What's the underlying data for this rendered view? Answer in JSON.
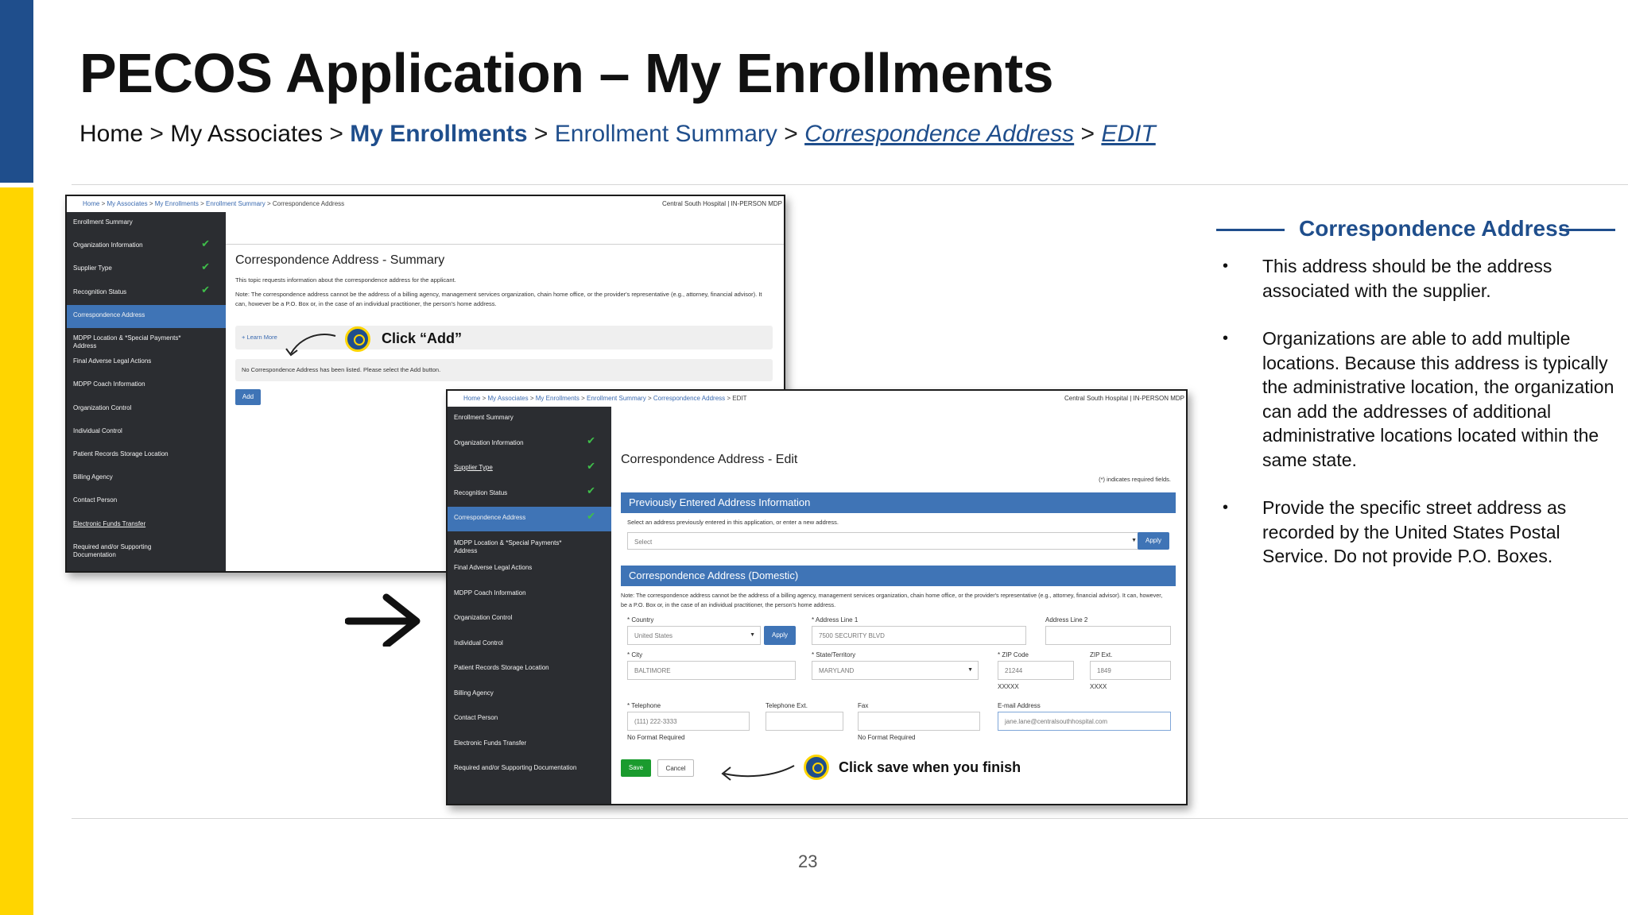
{
  "slide": {
    "title": "PECOS Application – My Enrollments",
    "page_number": "23",
    "breadcrumb": {
      "home": "Home",
      "sep": ">",
      "my_associates": "My Associates",
      "my_enrollments": "My Enrollments",
      "enrollment_summary": "Enrollment Summary",
      "correspondence_address": "Correspondence Address",
      "edit": "EDIT"
    }
  },
  "shot1": {
    "breadcrumb": [
      "Home",
      ">",
      "My Associates",
      ">",
      "My Enrollments",
      ">",
      "Enrollment Summary",
      ">",
      "Correspondence Address"
    ],
    "top_right": "Central South Hospital | IN-PERSON MDP",
    "sidebar": [
      {
        "label": "Enrollment Summary",
        "check": false
      },
      {
        "label": "Organization Information",
        "check": true
      },
      {
        "label": "Supplier Type",
        "check": true
      },
      {
        "label": "Recognition Status",
        "check": true
      },
      {
        "label": "Correspondence Address",
        "check": false,
        "active": true
      },
      {
        "label": "MDPP Location & *Special Payments* Address",
        "check": false
      },
      {
        "label": "Final Adverse Legal Actions",
        "check": false
      },
      {
        "label": "MDPP Coach Information",
        "check": false
      },
      {
        "label": "Organization Control",
        "check": false
      },
      {
        "label": "Individual Control",
        "check": false
      },
      {
        "label": "Patient Records Storage Location",
        "check": false
      },
      {
        "label": "Billing Agency",
        "check": false
      },
      {
        "label": "Contact Person",
        "check": false
      },
      {
        "label": "Electronic Funds Transfer",
        "check": false
      },
      {
        "label": "Required and/or Supporting Documentation",
        "check": false
      }
    ],
    "page_title": "Correspondence Address - Summary",
    "intro": "This topic requests information about the correspondence address for the applicant.",
    "note": "Note: The correspondence address cannot be the address of a billing agency, management services organization, chain home office, or the provider's representative (e.g., attorney, financial advisor). It can, however be a P.O. Box or, in the case of an individual practitioner, the person's home address.",
    "learn_more": "+ Learn More",
    "empty_msg": "No Correspondence Address has been listed. Please select the Add button.",
    "add_button": "Add",
    "callout": "Click “Add”"
  },
  "shot2": {
    "breadcrumb": [
      "Home",
      ">",
      "My Associates",
      ">",
      "My Enrollments",
      ">",
      "Enrollment Summary",
      ">",
      "Correspondence Address",
      ">",
      "EDIT"
    ],
    "top_right": "Central South Hospital | IN-PERSON MDP",
    "sidebar": [
      {
        "label": "Enrollment Summary",
        "check": false
      },
      {
        "label": "Organization Information",
        "check": true
      },
      {
        "label": "Supplier Type",
        "check": true
      },
      {
        "label": "Recognition Status",
        "check": true
      },
      {
        "label": "Correspondence Address",
        "check": true,
        "active": true
      },
      {
        "label": "MDPP Location & *Special Payments* Address",
        "check": false
      },
      {
        "label": "Final Adverse Legal Actions",
        "check": false
      },
      {
        "label": "MDPP Coach Information",
        "check": false
      },
      {
        "label": "Organization Control",
        "check": false
      },
      {
        "label": "Individual Control",
        "check": false
      },
      {
        "label": "Patient Records Storage Location",
        "check": false
      },
      {
        "label": "Billing Agency",
        "check": false
      },
      {
        "label": "Contact Person",
        "check": false
      },
      {
        "label": "Electronic Funds Transfer",
        "check": false
      },
      {
        "label": "Required and/or Supporting Documentation",
        "check": false
      }
    ],
    "page_title": "Correspondence Address - Edit",
    "required_note": "(*) indicates required fields.",
    "section1_title": "Previously Entered Address Information",
    "section1_help": "Select an address previously entered in this application, or enter a new address.",
    "select_placeholder": "Select",
    "apply": "Apply",
    "section2_title": "Correspondence Address (Domestic)",
    "note": "Note: The correspondence address cannot be the address of a billing agency, management services organization, chain home office, or the provider's representative (e.g., attorney, financial advisor). It can, however, be a P.O. Box or, in the case of an individual practitioner, the person's home address.",
    "fields": {
      "country_label": "* Country",
      "country_value": "United States",
      "address1_label": "* Address Line 1",
      "address1_value": "7500 SECURITY BLVD",
      "address2_label": "Address Line 2",
      "city_label": "* City",
      "city_value": "BALTIMORE",
      "state_label": "* State/Territory",
      "state_value": "MARYLAND",
      "zip_label": "* ZIP Code",
      "zip_value": "21244",
      "zip_hint": "XXXXX",
      "zipext_label": "ZIP Ext.",
      "zipext_value": "1849",
      "zipext_hint": "XXXX",
      "phone_label": "* Telephone",
      "phone_value": "(111) 222-3333",
      "phone_hint": "No Format Required",
      "phone_ext_label": "Telephone Ext.",
      "fax_label": "Fax",
      "fax_hint": "No Format Required",
      "email_label": "E-mail Address",
      "email_value": "jane.lane@centralsouthhospital.com"
    },
    "save": "Save",
    "cancel": "Cancel",
    "callout": "Click save when you finish"
  },
  "right_panel": {
    "title": "Correspondence Address",
    "bullets": [
      "This address should be the address associated with the supplier.",
      "Organizations are able to add multiple locations. Because this address is typically the administrative location, the organization can add the addresses of additional administrative locations located within the same state.",
      "Provide the specific street address as recorded by the United States Postal Service. Do not provide P.O. Boxes."
    ]
  },
  "colors": {
    "brand_blue": "#1f4e8c",
    "brand_yellow": "#ffd500",
    "sidebar_dark": "#2b2d31",
    "active_blue": "#3f74b6",
    "check_green": "#3fbf4a",
    "save_green": "#1a9b2e"
  }
}
